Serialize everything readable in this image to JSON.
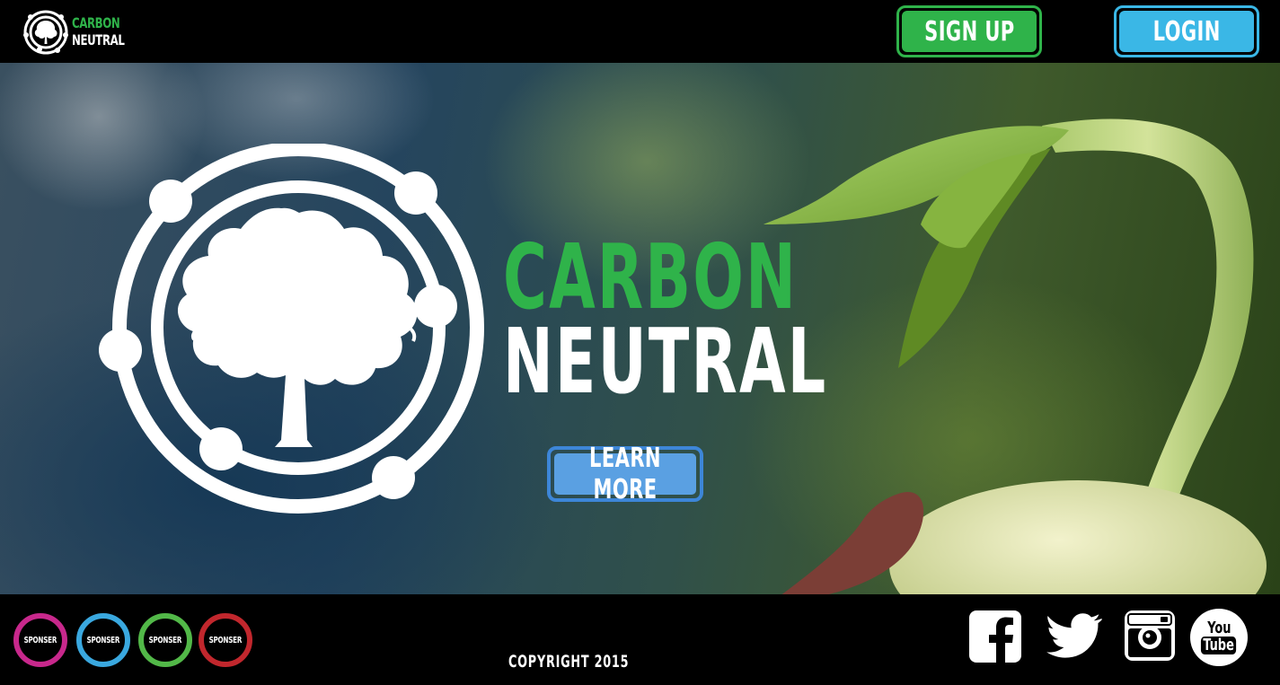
{
  "header": {
    "brand_line1": "CARBON",
    "brand_line2": "NEUTRAL",
    "signup_label": "SIGN UP",
    "login_label": "LOGIN"
  },
  "hero": {
    "title_line1": "CARBON",
    "title_line2": "NEUTRAL",
    "learn_more_label": "LEARN MORE"
  },
  "footer": {
    "sponsors": [
      "SPONSER",
      "SPONSER",
      "SPONSER",
      "SPONSER"
    ],
    "copyright": "COPYRIGHT 2015",
    "social": {
      "facebook_icon": "facebook-icon",
      "twitter_icon": "twitter-icon",
      "instagram_icon": "instagram-icon",
      "youtube_line1": "You",
      "youtube_line2": "Tube"
    }
  },
  "colors": {
    "green": "#2fb34a",
    "light_blue": "#3ab7e6",
    "blue": "#3d86d8",
    "sponsor_magenta": "#c8288c",
    "sponsor_blue": "#3aa8df",
    "sponsor_green": "#52b848",
    "sponsor_red": "#c1272d"
  }
}
